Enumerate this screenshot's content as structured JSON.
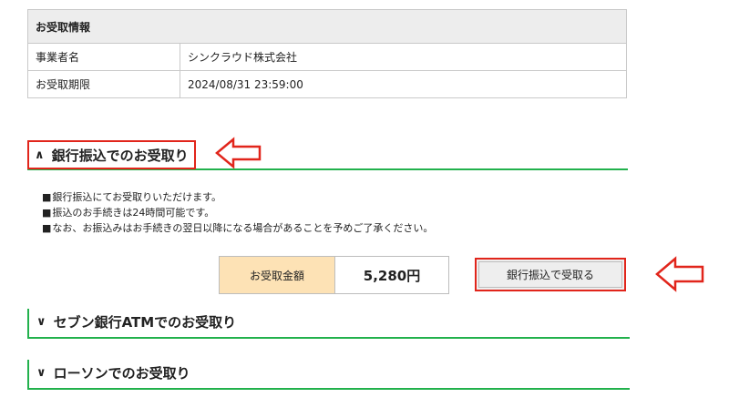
{
  "info": {
    "header": "お受取情報",
    "rows": [
      {
        "label": "事業者名",
        "value": "シンクラウド株式会社"
      },
      {
        "label": "お受取期限",
        "value": "2024/08/31 23:59:00"
      }
    ]
  },
  "bank": {
    "caret": "∧",
    "title": "銀行振込でのお受取り",
    "notes": [
      "銀行振込にてお受取りいただけます。",
      "振込のお手続きは24時間可能です。",
      "なお、お振込みはお手続きの翌日以降になる場合があることを予めご了承ください。"
    ],
    "amount_label": "お受取金額",
    "amount_value": "5,280円",
    "receive_button": "銀行振込で受取る"
  },
  "seven": {
    "caret": "∨",
    "title": "セブン銀行ATMでのお受取り"
  },
  "lawson": {
    "caret": "∨",
    "title": "ローソンでのお受取り"
  },
  "colors": {
    "accent_green": "#22b14c",
    "highlight_red": "#e1251b",
    "amount_bg": "#fde2b5"
  },
  "icons": {
    "annotation_arrow": "left-arrow-outline-icon"
  }
}
